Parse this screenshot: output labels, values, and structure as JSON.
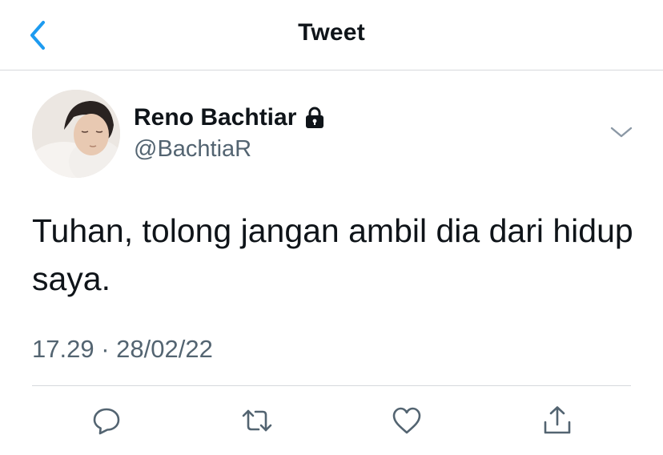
{
  "header": {
    "title": "Tweet"
  },
  "tweet": {
    "author": {
      "display_name": "Reno Bachtiar",
      "handle": "@BachtiaR",
      "protected": true
    },
    "text": "Tuhan, tolong jangan ambil dia dari hidup saya.",
    "time": "17.29",
    "separator": "·",
    "date": "28/02/22"
  },
  "actions": {
    "icons": [
      "reply-icon",
      "retweet-icon",
      "like-icon",
      "share-icon"
    ]
  },
  "colors": {
    "accent": "#1d9bf0",
    "text_primary": "#0f1419",
    "text_secondary": "#536471",
    "border": "#d6d9dc",
    "icon": "#536471"
  }
}
